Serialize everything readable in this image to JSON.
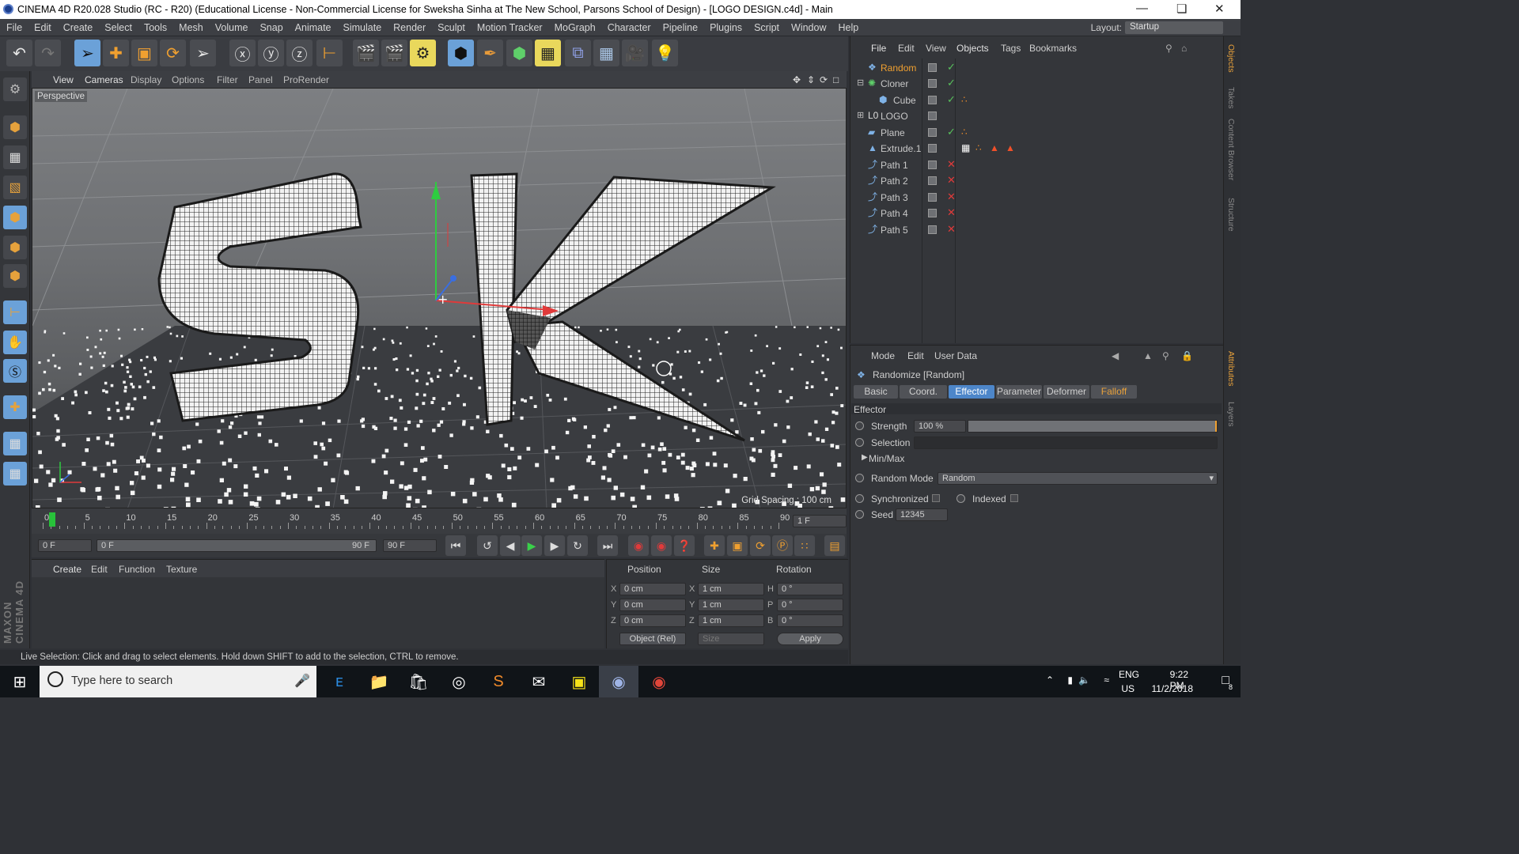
{
  "window": {
    "title": "CINEMA 4D R20.028 Studio (RC - R20) (Educational License - Non-Commercial License for Sweksha Sinha at The New School, Parsons School of Design) - [LOGO DESIGN.c4d] - Main"
  },
  "menubar": {
    "items": [
      "File",
      "Edit",
      "Create",
      "Select",
      "Tools",
      "Mesh",
      "Volume",
      "Snap",
      "Animate",
      "Simulate",
      "Render",
      "Sculpt",
      "Motion Tracker",
      "MoGraph",
      "Character",
      "Pipeline",
      "Plugins",
      "Script",
      "Window",
      "Help"
    ],
    "layout_label": "Layout:",
    "layout_value": "Startup"
  },
  "viewport": {
    "menu": [
      "View",
      "Cameras",
      "Display",
      "Options",
      "Filter",
      "Panel",
      "ProRender"
    ],
    "label": "Perspective",
    "grid_spacing": "Grid Spacing : 100 cm",
    "logo_text": "SK"
  },
  "timeline": {
    "ticks": [
      "0",
      "5",
      "10",
      "15",
      "20",
      "25",
      "30",
      "35",
      "40",
      "45",
      "50",
      "55",
      "60",
      "65",
      "70",
      "75",
      "80",
      "85",
      "90"
    ],
    "current_frame": "1 F",
    "start_field": "0 F",
    "range_start": "0 F",
    "range_end": "90 F",
    "end_field": "90 F"
  },
  "material_manager": {
    "menu": [
      "Create",
      "Edit",
      "Function",
      "Texture"
    ]
  },
  "coordinates": {
    "headers": [
      "Position",
      "Size",
      "Rotation"
    ],
    "axis_pos": [
      "X",
      "Y",
      "Z"
    ],
    "axis_rot": [
      "H",
      "P",
      "B"
    ],
    "position": [
      "0 cm",
      "0 cm",
      "0 cm"
    ],
    "size": [
      "1 cm",
      "1 cm",
      "1 cm"
    ],
    "rotation": [
      "0 °",
      "0 °",
      "0 °"
    ],
    "mode": "Object (Rel)",
    "size_mode": "Size",
    "apply": "Apply"
  },
  "status": "Live Selection: Click and drag to select elements. Hold down SHIFT to add to the selection, CTRL to remove.",
  "object_manager": {
    "menu": [
      "File",
      "Edit",
      "View",
      "Objects",
      "Tags",
      "Bookmarks"
    ],
    "objects": [
      {
        "name": "Random",
        "selected": true
      },
      {
        "name": "Cloner"
      },
      {
        "name": "Cube"
      },
      {
        "name": "LOGO"
      },
      {
        "name": "Plane"
      },
      {
        "name": "Extrude.1"
      },
      {
        "name": "Path 1"
      },
      {
        "name": "Path 2"
      },
      {
        "name": "Path 3"
      },
      {
        "name": "Path 4"
      },
      {
        "name": "Path 5"
      }
    ]
  },
  "attributes": {
    "menu": [
      "Mode",
      "Edit",
      "User Data"
    ],
    "object_title": "Randomize [Random]",
    "tabs": [
      "Basic",
      "Coord.",
      "Effector",
      "Parameter",
      "Deformer",
      "Falloff"
    ],
    "section": "Effector",
    "strength_label": "Strength",
    "strength_value": "100 %",
    "strength_fraction": 1.0,
    "selection_label": "Selection",
    "minmax_label": "Min/Max",
    "random_mode_label": "Random Mode",
    "random_mode_value": "Random",
    "synchronized_label": "Synchronized",
    "indexed_label": "Indexed",
    "seed_label": "Seed",
    "seed_value": "12345"
  },
  "right_tabs": [
    "Objects",
    "Takes",
    "Content Browser",
    "Structure",
    "Attributes",
    "Layers"
  ],
  "taskbar": {
    "search_placeholder": "Type here to search",
    "lang": "ENG",
    "region": "US",
    "time": "9:22 PM",
    "date": "11/2/2018",
    "notifications": "8"
  },
  "colors": {
    "accent": "#4d86c9",
    "selected_object": "#f0a030",
    "check": "#58c25c",
    "cross": "#e03a3a"
  }
}
